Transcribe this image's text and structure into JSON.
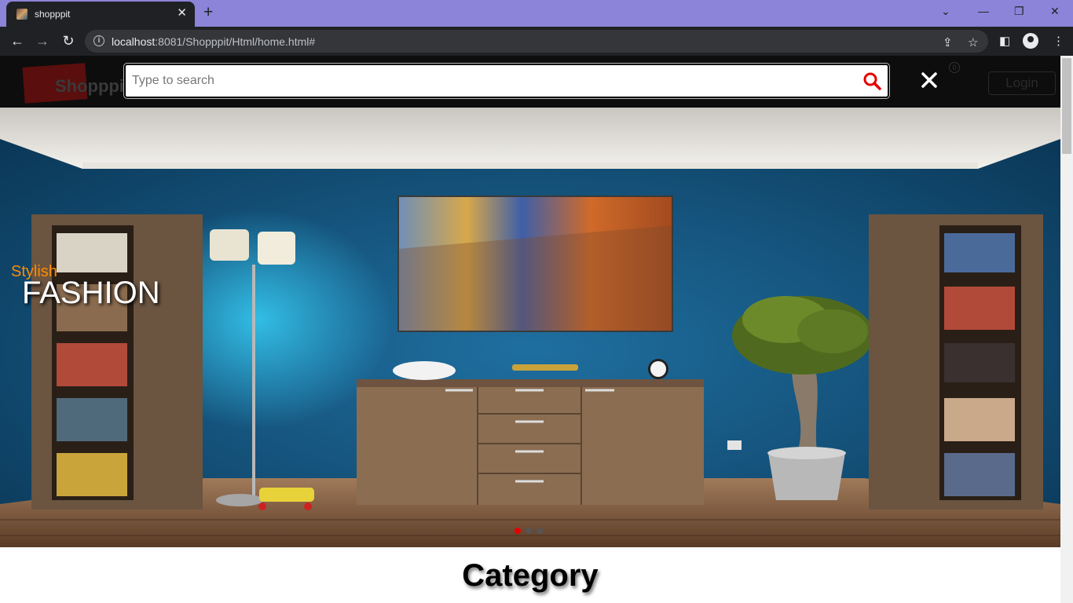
{
  "browser": {
    "tab_title": "shopppit",
    "url_host": "localhost",
    "url_rest": ":8081/Shopppit/Html/home.html#"
  },
  "site": {
    "logo_text": "Shopppit",
    "cart_count": "0",
    "login_label": "Login",
    "search_placeholder": "Type to search"
  },
  "hero": {
    "caption_small": "Stylish",
    "caption_big": "FASHION",
    "slides": 3,
    "active_slide": 1
  },
  "section": {
    "category_title": "Category"
  },
  "colors": {
    "accent": "#e60000",
    "caption_small": "#ff8c00",
    "tabbar": "#8b84d9",
    "chrome_dark": "#202124"
  },
  "icons": [
    "favicon-icon",
    "close-tab-icon",
    "new-tab-icon",
    "minimize-icon",
    "restore-icon",
    "close-window-icon",
    "back-icon",
    "forward-icon",
    "reload-icon",
    "info-icon",
    "share-icon",
    "star-icon",
    "sidepanel-icon",
    "profile-icon",
    "menu-icon",
    "search-icon",
    "close-icon"
  ]
}
